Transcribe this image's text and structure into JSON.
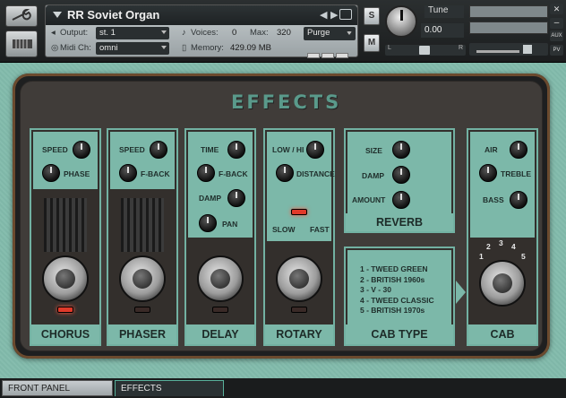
{
  "header": {
    "instrument_name": "RR Soviet Organ",
    "output_label": "Output:",
    "output_value": "st. 1",
    "midi_label": "Midi Ch:",
    "midi_value": "omni",
    "voices_label": "Voices:",
    "voices_value": "0",
    "max_label": "Max:",
    "max_value": "320",
    "purge_label": "Purge",
    "memory_label": "Memory:",
    "memory_value": "429.09 MB",
    "solo_label": "S",
    "mute_label": "M",
    "tune_label": "Tune",
    "tune_value": "0.00",
    "pan_left": "L",
    "pan_right": "R",
    "aux_label": "AUX",
    "pv_label": "PV"
  },
  "panel": {
    "title": "EFFECTS",
    "chorus": {
      "label": "CHORUS",
      "knob1": "SPEED",
      "knob2": "PHASE",
      "led_on": true
    },
    "phaser": {
      "label": "PHASER",
      "knob1": "SPEED",
      "knob2": "F-BACK",
      "led_on": false
    },
    "delay": {
      "label": "DELAY",
      "knob1": "TIME",
      "knob2": "F-BACK",
      "knob3": "DAMP",
      "knob4": "PAN",
      "led_on": false
    },
    "rotary": {
      "label": "ROTARY",
      "knob1": "LOW / HI",
      "knob2": "DISTANCE",
      "slow": "SLOW",
      "fast": "FAST",
      "led_on": false
    },
    "reverb": {
      "label": "REVERB",
      "knob1": "SIZE",
      "knob2": "DAMP",
      "knob3": "AMOUNT"
    },
    "cab_type": {
      "label": "CAB TYPE",
      "items": [
        "1 - TWEED GREEN",
        "2 - BRITISH 1960s",
        "3 - V - 30",
        "4 - TWEED CLASSIC",
        "5 - BRITISH 1970s"
      ]
    },
    "cab": {
      "label": "CAB",
      "knob1": "AIR",
      "knob2": "TREBLE",
      "knob3": "BASS",
      "positions": [
        "1",
        "2",
        "3",
        "4",
        "5"
      ]
    }
  },
  "tabs": {
    "front_panel": "FRONT PANEL",
    "effects": "EFFECTS"
  },
  "colors": {
    "teal": "#7cb8a9",
    "led_red": "#e03a2a",
    "panel_dark": "#403c39"
  }
}
